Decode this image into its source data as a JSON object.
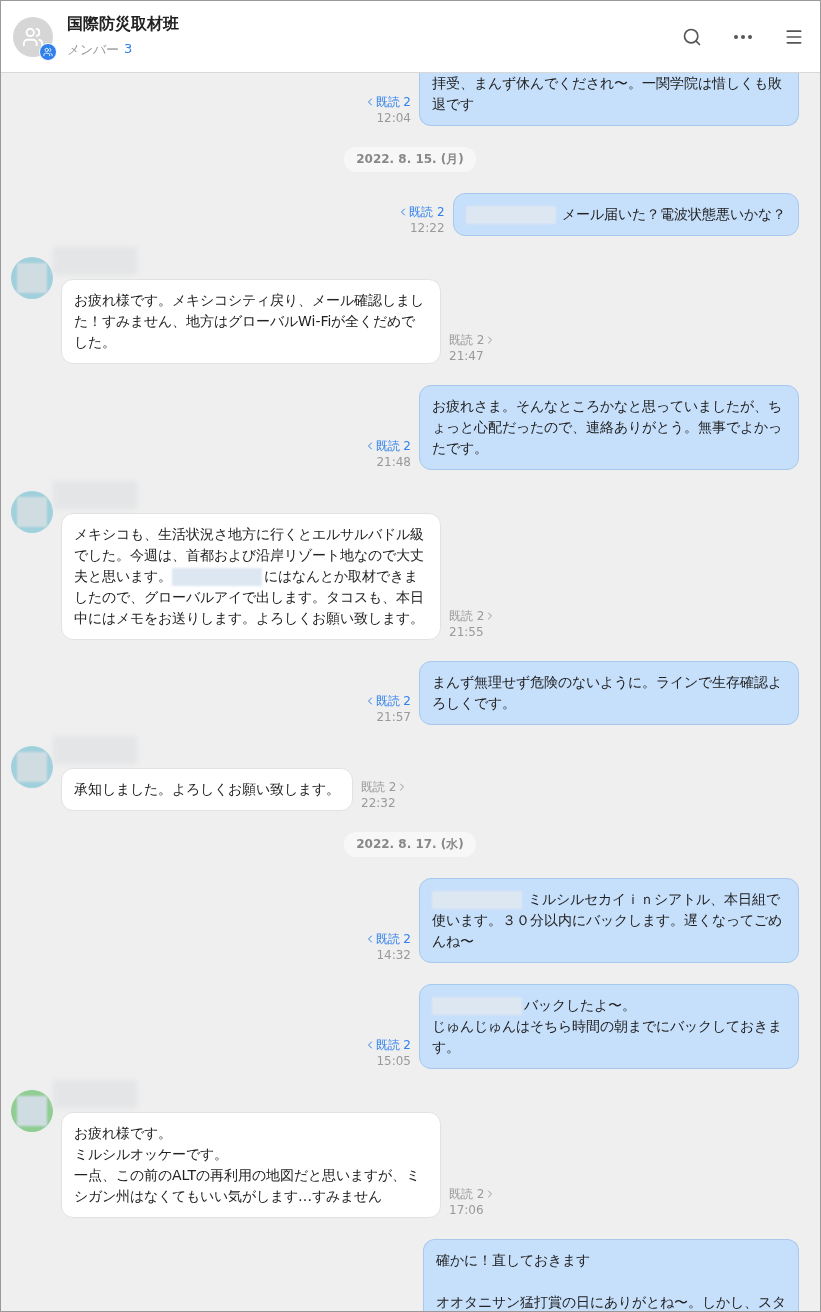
{
  "header": {
    "title": "国際防災取材班",
    "members_label": "メンバー",
    "members_count": "3"
  },
  "items": [
    {
      "kind": "sent",
      "cut_top": true,
      "body": [
        {
          "kind": "text",
          "text": "拝受、まんず休んでくだされ〜。一関学院は惜しくも敗退です"
        }
      ],
      "read": "既読 2",
      "time": "12:04"
    },
    {
      "kind": "date",
      "label": "2022. 8. 15. (月)"
    },
    {
      "kind": "sent",
      "body": [
        {
          "kind": "redacted"
        },
        {
          "kind": "text",
          "text": " メール届いた？電波状態悪いかな？"
        }
      ],
      "read": "既読 2",
      "time": "12:22"
    },
    {
      "kind": "received",
      "color": "#9fd0dc",
      "body": [
        {
          "kind": "text",
          "text": "お疲れ様です。メキシコシティ戻り、メール確認しました！すみません、地方はグローバルWi-Fiが全くだめでした。"
        }
      ],
      "read": "既読 2",
      "time": "21:47"
    },
    {
      "kind": "sent",
      "body": [
        {
          "kind": "text",
          "text": "お疲れさま。そんなところかなと思っていましたが、ちょっと心配だったので、連絡ありがとう。無事でよかったです。"
        }
      ],
      "read": "既読 2",
      "time": "21:48"
    },
    {
      "kind": "received",
      "color": "#9fd0dc",
      "body": [
        {
          "kind": "text",
          "text": "メキシコも、生活状況さ地方に行くとエルサルバドル級でした。今週は、首都および沿岸リゾート地なので大丈夫と思います。"
        },
        {
          "kind": "redacted"
        },
        {
          "kind": "text",
          "text": "にはなんとか取材できましたので、グローバルアイで出します。タコスも、本日中にはメモをお送りします。よろしくお願い致します。"
        }
      ],
      "read": "既読 2",
      "time": "21:55"
    },
    {
      "kind": "sent",
      "body": [
        {
          "kind": "text",
          "text": "まんず無理せず危険のないように。ラインで生存確認よろしくです。"
        }
      ],
      "read": "既読 2",
      "time": "21:57"
    },
    {
      "kind": "received",
      "color": "#9fd0dc",
      "body": [
        {
          "kind": "text",
          "text": "承知しました。よろしくお願い致します。"
        }
      ],
      "read": "既読 2",
      "time": "22:32"
    },
    {
      "kind": "date",
      "label": "2022. 8. 17. (水)"
    },
    {
      "kind": "sent",
      "body": [
        {
          "kind": "redacted"
        },
        {
          "kind": "text",
          "text": " ミルシルセカイｉｎシアトル、本日組で使います。３０分以内にバックします。遅くなってごめんね〜"
        }
      ],
      "read": "既読 2",
      "time": "14:32"
    },
    {
      "kind": "sent",
      "body": [
        {
          "kind": "redacted"
        },
        {
          "kind": "text",
          "text": "バックしたよ〜。"
        },
        {
          "kind": "break"
        },
        {
          "kind": "text",
          "text": "じゅんじゅんはそちら時間の朝までにバックしておきます。"
        }
      ],
      "read": "既読 2",
      "time": "15:05"
    },
    {
      "kind": "received",
      "color": "#8fcd93",
      "body": [
        {
          "kind": "text",
          "text": "お疲れ様です。"
        },
        {
          "kind": "break"
        },
        {
          "kind": "text",
          "text": "ミルシルオッケーです。"
        },
        {
          "kind": "break"
        },
        {
          "kind": "text",
          "text": "一点、この前のALTの再利用の地図だと思いますが、ミシガン州はなくてもいい気がします…すみません"
        }
      ],
      "read": "既読 2",
      "time": "17:06"
    },
    {
      "kind": "sent",
      "cut_bottom": true,
      "body": [
        {
          "kind": "text",
          "text": "確かに！直しておきます"
        },
        {
          "kind": "break"
        },
        {
          "kind": "break"
        },
        {
          "kind": "text",
          "text": "オオタニサン猛打賞の日にありがとね〜。しかし、スタ"
        }
      ]
    }
  ]
}
